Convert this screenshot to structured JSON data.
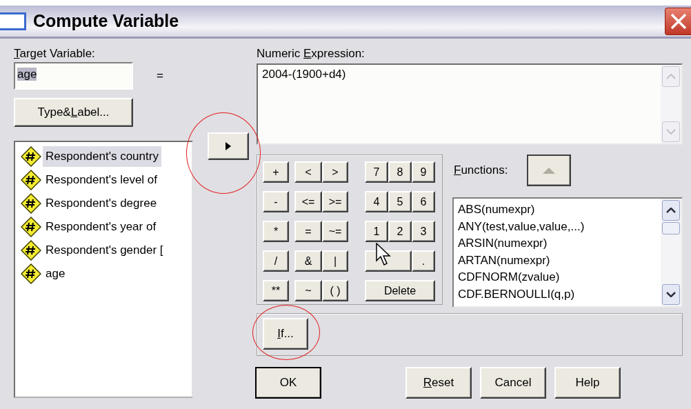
{
  "window": {
    "title": "Compute Variable"
  },
  "target_variable": {
    "label": "Target Variable:",
    "value": "age",
    "equals": "=",
    "type_label_button": "Type&Label..."
  },
  "variables": [
    {
      "label": "Respondent's country",
      "selected": true
    },
    {
      "label": "Respondent's level of",
      "selected": false
    },
    {
      "label": "Respondent's degree",
      "selected": false
    },
    {
      "label": "Respondent's year of",
      "selected": false
    },
    {
      "label": "Respondent's gender [",
      "selected": false
    },
    {
      "label": "age",
      "selected": false
    }
  ],
  "numeric_expression": {
    "label": "Numeric Expression:",
    "value": "2004-(1900+d4)"
  },
  "keypad": [
    [
      {
        "label": "+",
        "kind": "single"
      },
      {
        "label": "<",
        "kind": "single"
      },
      {
        "label": ">",
        "kind": "single"
      },
      {
        "label": "7",
        "kind": "single"
      },
      {
        "label": "8",
        "kind": "single"
      },
      {
        "label": "9",
        "kind": "single"
      }
    ],
    [
      {
        "label": "-",
        "kind": "single"
      },
      {
        "label": "<=",
        "kind": "single"
      },
      {
        "label": ">=",
        "kind": "single"
      },
      {
        "label": "4",
        "kind": "single"
      },
      {
        "label": "5",
        "kind": "single"
      },
      {
        "label": "6",
        "kind": "single"
      }
    ],
    [
      {
        "label": "*",
        "kind": "single"
      },
      {
        "label": "=",
        "kind": "single"
      },
      {
        "label": "~=",
        "kind": "single"
      },
      {
        "label": "1",
        "kind": "single"
      },
      {
        "label": "2",
        "kind": "single"
      },
      {
        "label": "3",
        "kind": "single"
      }
    ],
    [
      {
        "label": "/",
        "kind": "single"
      },
      {
        "label": "&",
        "kind": "single"
      },
      {
        "label": "|",
        "kind": "single"
      },
      {
        "kind": "double"
      },
      {
        "label": ".",
        "kind": "single"
      }
    ],
    [
      {
        "label": "**",
        "kind": "single"
      },
      {
        "label": "~",
        "kind": "single"
      },
      {
        "label": "( )",
        "kind": "single"
      },
      {
        "label": "Delete",
        "kind": "triple"
      }
    ]
  ],
  "functions": {
    "label": "Functions:",
    "items": [
      "ABS(numexpr)",
      "ANY(test,value,value,...)",
      "ARSIN(numexpr)",
      "ARTAN(numexpr)",
      "CDFNORM(zvalue)",
      "CDF.BERNOULLI(q,p)"
    ]
  },
  "if_button": "If...",
  "buttons": [
    {
      "label": "OK",
      "default": true
    },
    {
      "label": "Reset",
      "default": false
    },
    {
      "label": "Cancel",
      "default": false
    },
    {
      "label": "Help",
      "default": false
    }
  ]
}
